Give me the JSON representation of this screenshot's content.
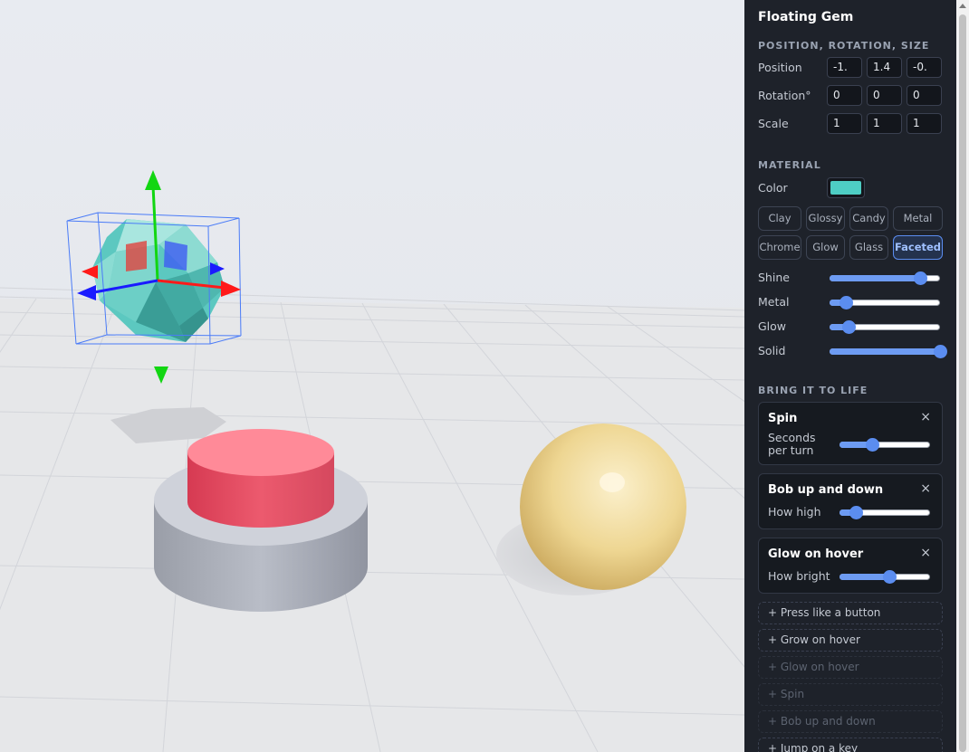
{
  "object_title": "Floating Gem",
  "transform": {
    "heading": "POSITION, ROTATION, SIZE",
    "rows": [
      {
        "label": "Position",
        "values": [
          "-1.",
          "1.4",
          "-0."
        ]
      },
      {
        "label": "Rotation°",
        "values": [
          "0",
          "0",
          "0"
        ]
      },
      {
        "label": "Scale",
        "values": [
          "1",
          "1",
          "1"
        ]
      }
    ]
  },
  "material": {
    "heading": "MATERIAL",
    "color_label": "Color",
    "color_value": "#4ecdc4",
    "presets": [
      "Clay",
      "Glossy",
      "Candy",
      "Metal",
      "Chrome",
      "Glow",
      "Glass",
      "Faceted"
    ],
    "active_preset": "Faceted",
    "sliders": [
      {
        "label": "Shine",
        "value": 0.82
      },
      {
        "label": "Metal",
        "value": 0.15
      },
      {
        "label": "Glow",
        "value": 0.17
      },
      {
        "label": "Solid",
        "value": 1.0
      }
    ]
  },
  "behaviors": {
    "heading": "BRING IT TO LIFE",
    "active": [
      {
        "title": "Spin",
        "param": "Seconds per turn",
        "value": 0.36
      },
      {
        "title": "Bob up and down",
        "param": "How high",
        "value": 0.18
      },
      {
        "title": "Glow on hover",
        "param": "How bright",
        "value": 0.55
      }
    ],
    "close_glyph": "×",
    "available": [
      {
        "label": "+ Press like a button",
        "enabled": true
      },
      {
        "label": "+ Grow on hover",
        "enabled": true
      },
      {
        "label": "+ Glow on hover",
        "enabled": false
      },
      {
        "label": "+ Spin",
        "enabled": false
      },
      {
        "label": "+ Bob up and down",
        "enabled": false
      },
      {
        "label": "+ Jump on a key",
        "enabled": true
      }
    ]
  },
  "colors": {
    "accent": "#5b8df0",
    "gem": "#4ecdc4",
    "button_top": "#f06b7e",
    "button_base": "#b8bcc6",
    "sphere": "#f0d890",
    "gizmo_x": "#ff2020",
    "gizmo_y": "#20e020",
    "gizmo_z": "#2020ff"
  }
}
